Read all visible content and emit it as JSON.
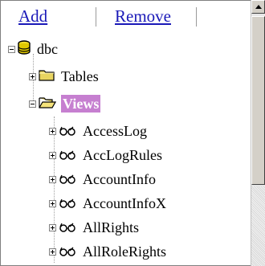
{
  "toolbar": {
    "add_label": "Add",
    "remove_label": "Remove"
  },
  "tree": {
    "root": {
      "label": "dbc",
      "icon": "database-icon",
      "expanded": true
    },
    "tables": {
      "label": "Tables",
      "icon": "folder-closed-icon",
      "expanded": false
    },
    "views": {
      "label": "Views",
      "icon": "folder-open-icon",
      "expanded": true,
      "selected": true
    },
    "view_items": [
      {
        "label": "AccessLog",
        "icon": "glasses-icon"
      },
      {
        "label": "AccLogRules",
        "icon": "glasses-icon"
      },
      {
        "label": "AccountInfo",
        "icon": "glasses-icon"
      },
      {
        "label": "AccountInfoX",
        "icon": "glasses-icon"
      },
      {
        "label": "AllRights",
        "icon": "glasses-icon"
      },
      {
        "label": "AllRoleRights",
        "icon": "glasses-icon"
      }
    ]
  },
  "colors": {
    "link": "#1a19b8",
    "selection": "#c67fd0",
    "folder": "#e8d460",
    "database": "#e0c800"
  }
}
